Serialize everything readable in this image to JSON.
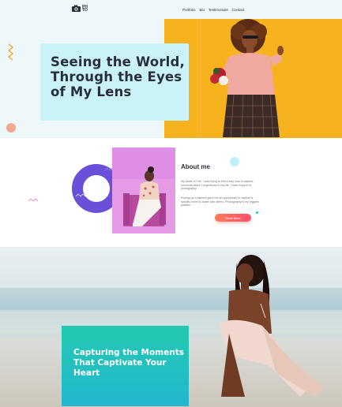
{
  "header": {
    "logo_text": "PH TO",
    "nav": [
      "Portfolio",
      "Bio",
      "Testimonials",
      "Contact"
    ]
  },
  "hero": {
    "title": "Seeing the World, Through the Eyes of My Lens"
  },
  "about": {
    "title": "About me",
    "paragraph1": "My name is Cris. I was trying to find a way how to capture moments which I experience in my life. I have found it in photography.",
    "paragraph2": "Picking up a camera gave me an opportunity to capture a specific event to share with others. Photography is my biggest passion.",
    "read_more": "Read More"
  },
  "feature": {
    "title": "Capturing the Moments That Captivate Your Heart"
  },
  "colors": {
    "hero_bg": "#eef8fb",
    "hero_card": "#c9f3f7",
    "photo_yellow": "#f7b31e",
    "accent_purple": "#6a4fd8",
    "accent_coral": "#ff5f6d",
    "teal": "#24c9b0"
  }
}
